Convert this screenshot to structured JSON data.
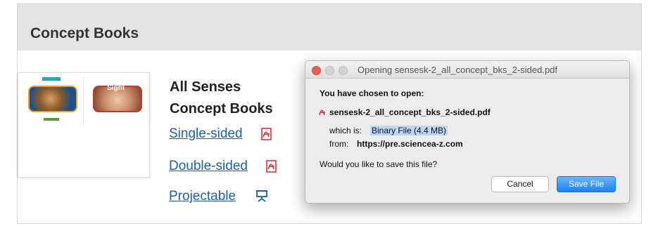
{
  "panel": {
    "title": "Concept Books",
    "book_title_line1": "All Senses",
    "book_title_line2": "Concept Books",
    "thumb2_word": "Sight",
    "links": [
      {
        "label": "Single-sided",
        "icon": "pdf-icon"
      },
      {
        "label": "Double-sided",
        "icon": "pdf-icon"
      },
      {
        "label": "Projectable",
        "icon": "projector-icon"
      }
    ]
  },
  "dialog": {
    "title": "Opening sensesk-2_all_concept_bks_2-sided.pdf",
    "prompt": "You have chosen to open:",
    "filename": "sensesk-2_all_concept_bks_2-sided.pdf",
    "which_is_label": "which is:",
    "which_is_value": "Binary File (4.4 MB)",
    "from_label": "from:",
    "from_value": "https://pre.sciencea-z.com",
    "question": "Would you like to save this file?",
    "cancel_label": "Cancel",
    "save_label": "Save File"
  },
  "colors": {
    "link": "#1a5fb4",
    "pdf_icon": "#d0262e",
    "save_button": "#1a82fb",
    "highlight": "#bcd6f5"
  }
}
